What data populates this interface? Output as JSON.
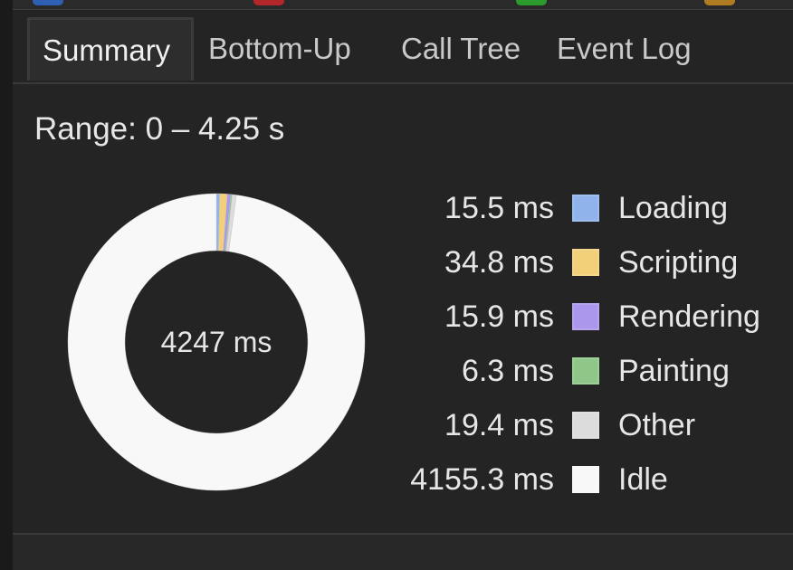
{
  "tabs": [
    {
      "label": "Summary",
      "active": true
    },
    {
      "label": "Bottom-Up",
      "active": false
    },
    {
      "label": "Call Tree",
      "active": false
    },
    {
      "label": "Event Log",
      "active": false
    }
  ],
  "range_label": "Range: 0 – 4.25 s",
  "total_label": "4247 ms",
  "chart_data": {
    "type": "pie",
    "categories": [
      "Loading",
      "Scripting",
      "Rendering",
      "Painting",
      "Other",
      "Idle"
    ],
    "values": [
      15.5,
      34.8,
      15.9,
      6.3,
      19.4,
      4155.3
    ],
    "value_labels": [
      "15.5 ms",
      "34.8 ms",
      "15.9 ms",
      "6.3 ms",
      "19.4 ms",
      "4155.3 ms"
    ],
    "colors": [
      "#8fb3ea",
      "#f2cf79",
      "#ab97ec",
      "#8ec788",
      "#dcdcdc",
      "#f8f8f8"
    ],
    "total": 4247,
    "donut": true
  }
}
